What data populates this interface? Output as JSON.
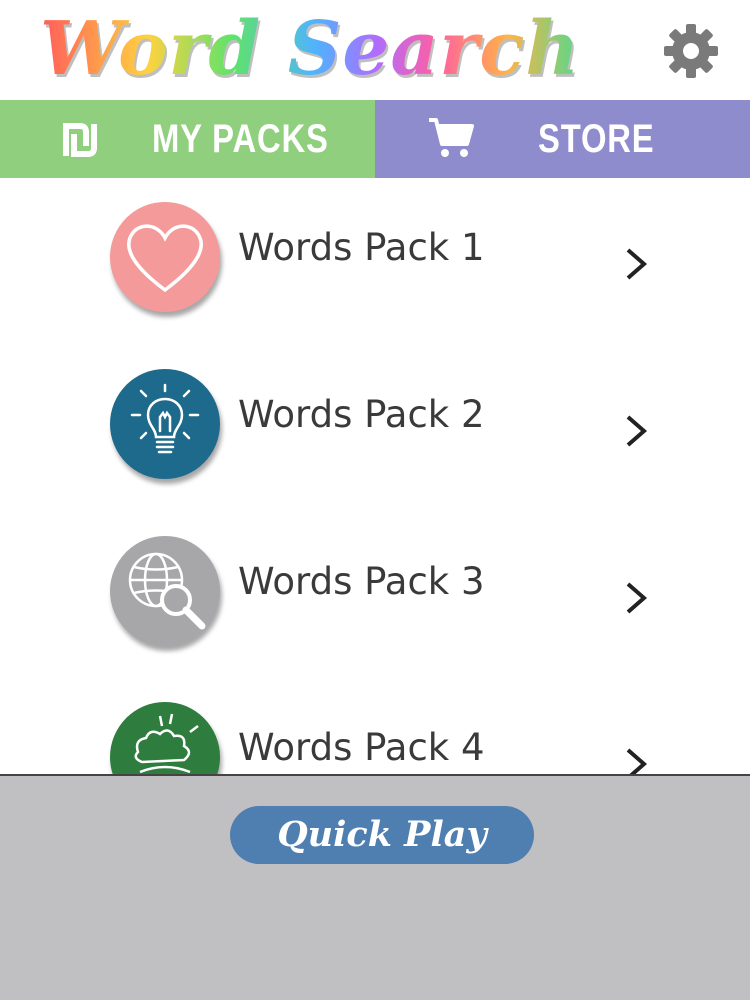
{
  "header": {
    "title": "Word Search",
    "settings_icon": "gear-icon"
  },
  "tabs": [
    {
      "label": "MY PACKS",
      "icon": "shekel-icon",
      "color": "#90cf7e"
    },
    {
      "label": "STORE",
      "icon": "shopping-cart-icon",
      "color": "#8f8ccd"
    }
  ],
  "packs": [
    {
      "label": "Words Pack 1",
      "icon": "heart-icon",
      "color": "#f49a9a"
    },
    {
      "label": "Words Pack 2",
      "icon": "lightbulb-icon",
      "color": "#1e6a8c"
    },
    {
      "label": "Words Pack 3",
      "icon": "globe-search-icon",
      "color": "#a7a7a9"
    },
    {
      "label": "Words Pack 4",
      "icon": "explosion-icon",
      "color": "#2e7d3e"
    }
  ],
  "bottom": {
    "quick_play_label": "Quick Play",
    "background": "#c0c0c2",
    "button_color": "#4f7fb1"
  }
}
